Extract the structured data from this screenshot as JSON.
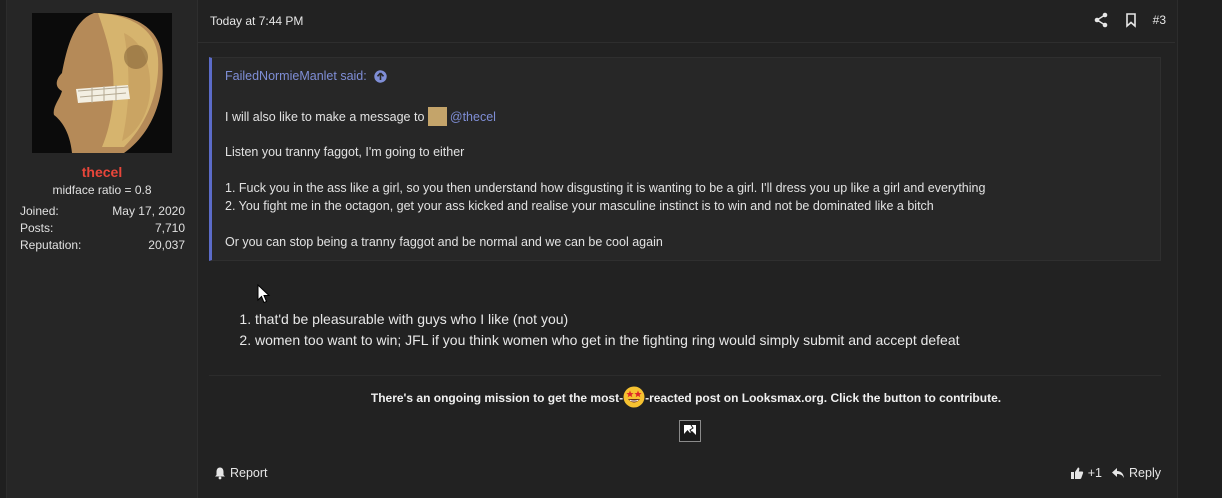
{
  "post": {
    "date": "Today at 7:44 PM",
    "number": "#3",
    "header_icons": [
      "share-icon",
      "bookmark-icon"
    ]
  },
  "user": {
    "name": "thecel",
    "title": "midface ratio = 0.8",
    "stats": [
      {
        "label": "Joined:",
        "value": "May 17, 2020"
      },
      {
        "label": "Posts:",
        "value": "7,710"
      },
      {
        "label": "Reputation:",
        "value": "20,037"
      }
    ]
  },
  "quote": {
    "author_line": "FailedNormieManlet said:",
    "line1_prefix": "I will also like to make a message to",
    "mention": "@thecel",
    "line2": "Listen you tranny faggot, I'm going to either",
    "line3": "1. Fuck you in the ass like a girl, so you then understand how disgusting it is wanting to be a girl. I'll dress you up like a girl and everything",
    "line4": "2. You fight me in the octagon, get your ass kicked and realise your masculine instinct is to win and not be dominated like a bitch",
    "line5": "Or you can stop being a tranny faggot and be normal and we can be cool again"
  },
  "reply": {
    "items": [
      "that'd be pleasurable with guys who I like (not you)",
      "women too want to win; JFL if you think women who get in the fighting ring would simply submit and accept defeat"
    ]
  },
  "mission": {
    "before": "There's an ongoing mission to get the most-",
    "after": "-reacted post on Looksmax.org. Click the button to contribute."
  },
  "footer": {
    "report": "Report",
    "like": "+1",
    "reply": "Reply"
  },
  "colors": {
    "background": "#1f1f1f",
    "username": "#e8463a",
    "quote_accent": "#5b6bc8",
    "link": "#7f8ed6"
  }
}
